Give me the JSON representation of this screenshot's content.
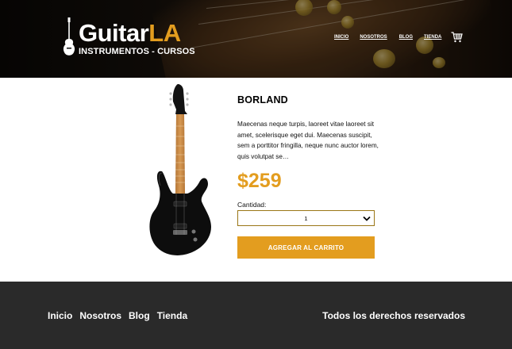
{
  "header": {
    "brand_main": "Guitar",
    "brand_accent": "LA",
    "tagline": "INSTRUMENTOS - CURSOS",
    "nav": [
      "INICIO",
      "NOSOTROS",
      "BLOG",
      "TIENDA"
    ]
  },
  "product": {
    "title": "BORLAND",
    "description": "Maecenas neque turpis, laoreet vitae laoreet sit amet, scelerisque eget dui. Maecenas suscipit, sem a porttitor fringilla, neque nunc auctor lorem, quis volutpat se…",
    "price": "$259",
    "quantity_label": "Cantidad:",
    "quantity_value": "1",
    "add_button": "AGREGAR AL CARRITO"
  },
  "footer": {
    "nav": [
      "Inicio",
      "Nosotros",
      "Blog",
      "Tienda"
    ],
    "copyright": "Todos los derechos reservados"
  },
  "colors": {
    "accent": "#e39d1f",
    "footer_bg": "#2a2a2a",
    "header_bg": "#0a0806"
  },
  "icons": {
    "logo": "guitar-icon",
    "cart": "cart-icon",
    "select": "chevron-down-icon"
  }
}
